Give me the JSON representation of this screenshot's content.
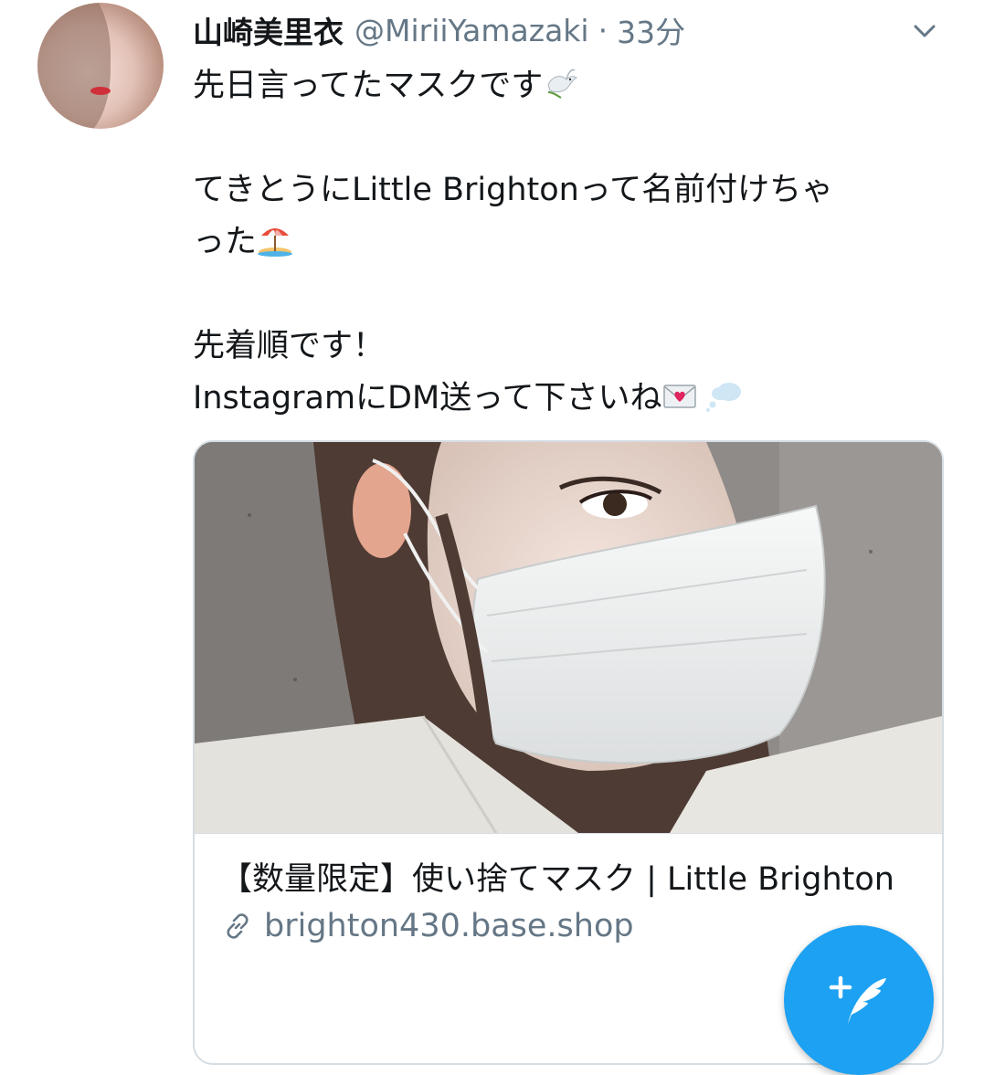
{
  "tweet": {
    "display_name": "山崎美里衣",
    "handle": "@MiriiYamazaki",
    "separator": "·",
    "timestamp": "33分",
    "text": {
      "line1": "先日言ってたマスクです",
      "line2": "てきとうにLittle Brightonって名前付けちゃ",
      "line3": "った",
      "line4": "先着順です！",
      "line5": "InstagramにDM送って下さいね"
    }
  },
  "card": {
    "title": "【数量限定】使い捨てマスク | Little Brighton",
    "domain": "brighton430.base.shop"
  },
  "icons": {
    "menu": "chevron-down-icon",
    "dove_emoji": "dove-icon",
    "beach_emoji": "beach-umbrella-icon",
    "letter_emoji": "love-letter-icon",
    "thought_emoji": "thought-balloon-icon",
    "link": "link-icon",
    "compose": "compose-tweet-icon"
  },
  "colors": {
    "accent": "#1da1f2",
    "secondary_text": "#657786",
    "primary_text": "#14171a",
    "card_border": "#d5dde3"
  }
}
